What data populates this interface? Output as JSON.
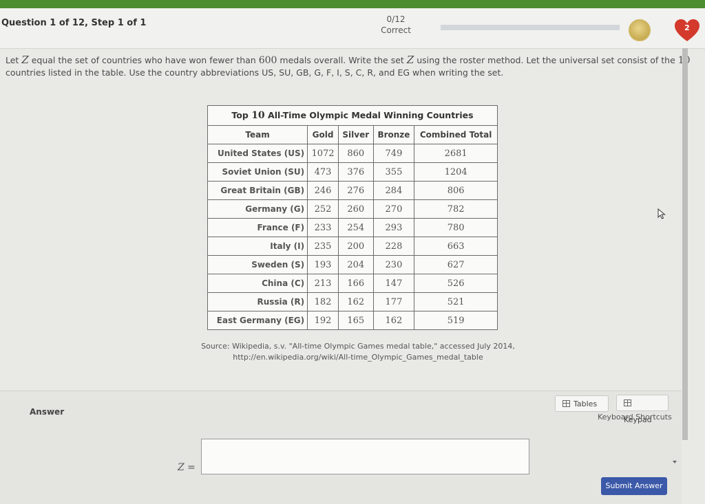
{
  "header": {
    "question_info": "Question 1 of 12, Step 1 of 1",
    "score": "0/12",
    "status": "Correct",
    "streak_count": "2",
    "progress_fraction": 0.0
  },
  "prompt": {
    "p1": "Let ",
    "var1": "Z",
    "p2": " equal the set of countries who have won fewer than ",
    "num": "600",
    "p3": " medals overall. Write the set ",
    "var2": "Z",
    "p4": " using the roster method. Let the universal set consist of the ",
    "num2": "10",
    "p5": " countries listed in the table. Use the country abbreviations US, SU, GB, G, F, I, S, C, R, and EG when writing the set."
  },
  "table": {
    "title_pre": "Top ",
    "title_num": "10",
    "title_post": " All-Time Olympic Medal Winning Countries",
    "headers": [
      "Team",
      "Gold",
      "Silver",
      "Bronze",
      "Combined Total"
    ],
    "rows": [
      [
        "United States (US)",
        "1072",
        "860",
        "749",
        "2681"
      ],
      [
        "Soviet Union (SU)",
        "473",
        "376",
        "355",
        "1204"
      ],
      [
        "Great Britain (GB)",
        "246",
        "276",
        "284",
        "806"
      ],
      [
        "Germany (G)",
        "252",
        "260",
        "270",
        "782"
      ],
      [
        "France (F)",
        "233",
        "254",
        "293",
        "780"
      ],
      [
        "Italy (I)",
        "235",
        "200",
        "228",
        "663"
      ],
      [
        "Sweden (S)",
        "193",
        "204",
        "230",
        "627"
      ],
      [
        "China (C)",
        "213",
        "166",
        "147",
        "526"
      ],
      [
        "Russia (R)",
        "182",
        "162",
        "177",
        "521"
      ],
      [
        "East Germany (EG)",
        "192",
        "165",
        "162",
        "519"
      ]
    ]
  },
  "source": {
    "line1": "Source: Wikipedia, s.v. \"All-time Olympic Games medal table,\" accessed July 2014,",
    "line2": "http://en.wikipedia.org/wiki/All-time_Olympic_Games_medal_table"
  },
  "answer": {
    "label": "Answer",
    "tables_button": "Tables",
    "keypad_button": "Keypad",
    "keyboard_shortcuts": "Keyboard Shortcuts",
    "variable": "Z",
    "equals": " =",
    "input_value": "",
    "submit_button": "Submit Answer"
  },
  "colors": {
    "accent_green": "#4c8d2f",
    "submit_blue": "#3b59a8",
    "heart_red": "#d33a2c"
  },
  "icons": [
    "medal-icon",
    "heart-icon",
    "table-icon",
    "keypad-icon",
    "cursor-icon"
  ]
}
